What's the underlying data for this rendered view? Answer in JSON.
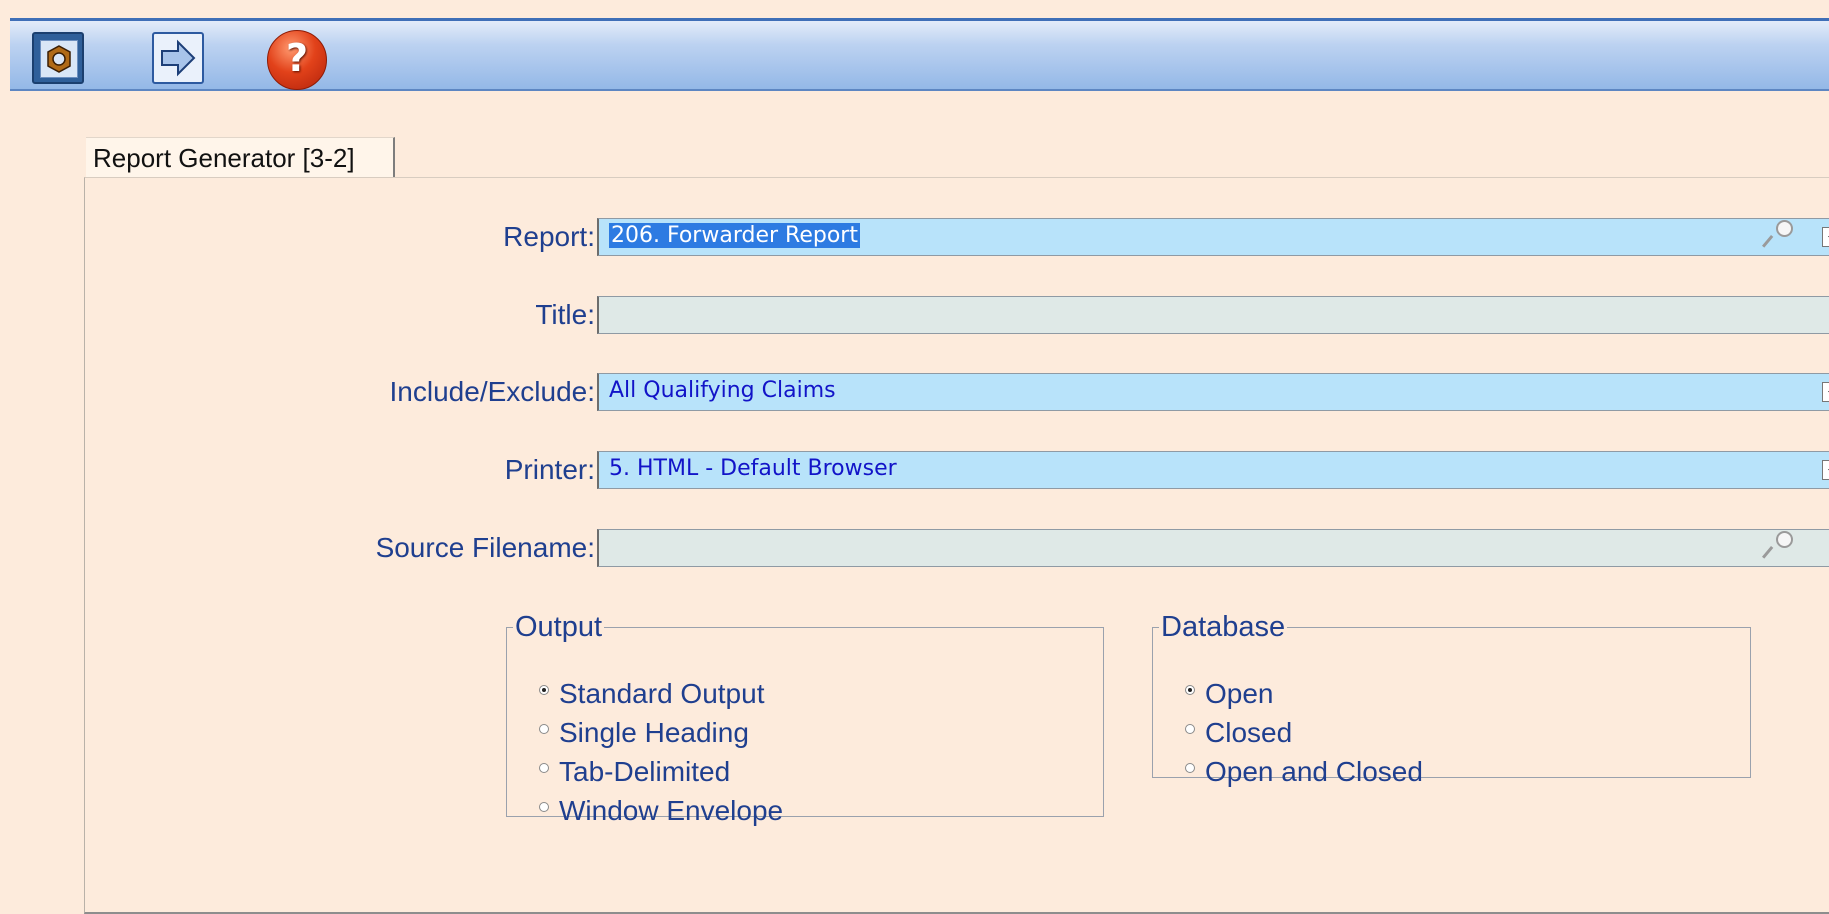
{
  "toolbar": {
    "buttons": [
      {
        "icon": "exit-icon"
      },
      {
        "icon": "arrow-right-icon"
      },
      {
        "icon": "help-icon",
        "glyph": "?"
      }
    ]
  },
  "tab": {
    "label": "Report Generator [3-2]"
  },
  "form": {
    "report": {
      "label": "Report:",
      "value": "206. Forwarder Report"
    },
    "title": {
      "label": "Title:",
      "value": ""
    },
    "include_exclude": {
      "label": "Include/Exclude:",
      "value": "All Qualifying Claims"
    },
    "printer": {
      "label": "Printer:",
      "value": "5. HTML - Default Browser"
    },
    "source_filename": {
      "label": "Source Filename:",
      "value": ""
    }
  },
  "output_group": {
    "legend": "Output",
    "options": [
      "Standard Output",
      "Single Heading",
      "Tab-Delimited",
      "Window Envelope"
    ],
    "selected": "Standard Output"
  },
  "database_group": {
    "legend": "Database",
    "options": [
      "Open",
      "Closed",
      "Open and Closed"
    ],
    "selected": "Open"
  },
  "colors": {
    "background": "#fdebdc",
    "label_text": "#1f3f8f",
    "combo_fill": "#b8e3fa",
    "text_field_fill": "#dfe9e7",
    "field_text": "#1214c8",
    "selection": "#2d7be2"
  }
}
